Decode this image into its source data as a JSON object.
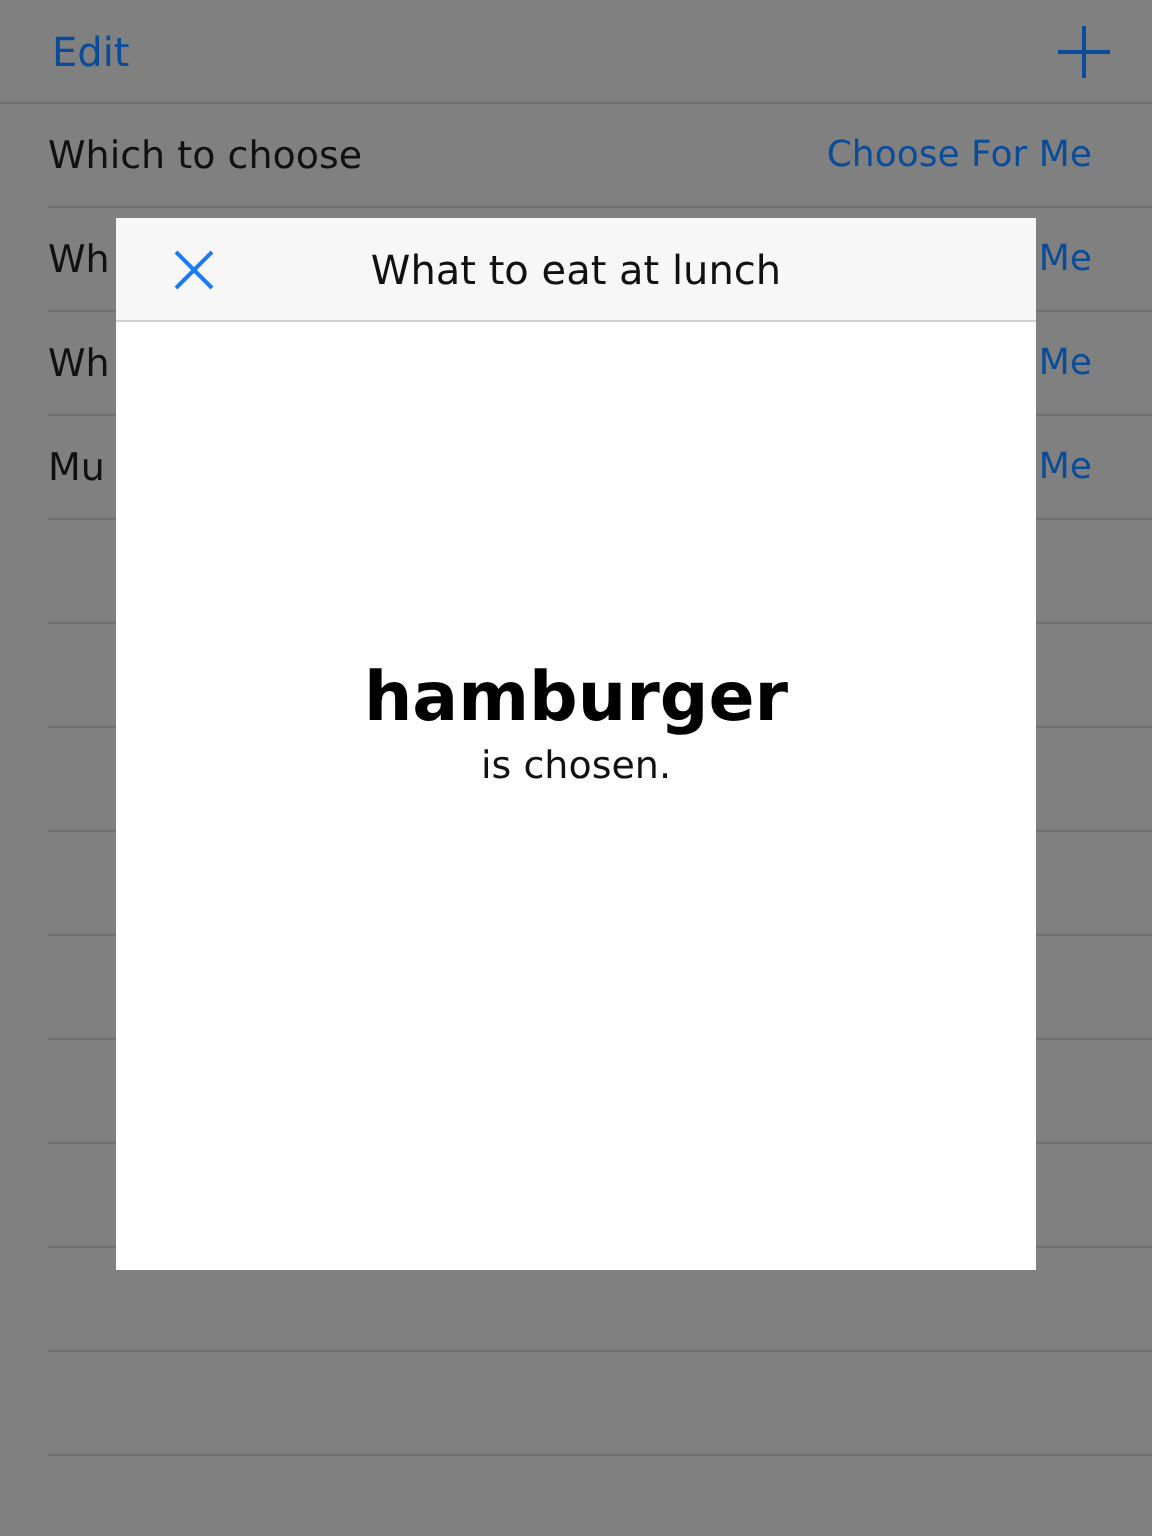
{
  "nav_bar": {
    "edit_button": "Edit"
  },
  "list": {
    "rows": [
      {
        "title": "Which to choose",
        "action": "Choose For Me"
      },
      {
        "title": "Wh",
        "action": "Me"
      },
      {
        "title": "Wh",
        "action": "Me"
      },
      {
        "title": "Mu",
        "action": "Me"
      }
    ]
  },
  "modal": {
    "title": "What to eat at lunch",
    "result": "hamburger",
    "caption": "is chosen."
  }
}
